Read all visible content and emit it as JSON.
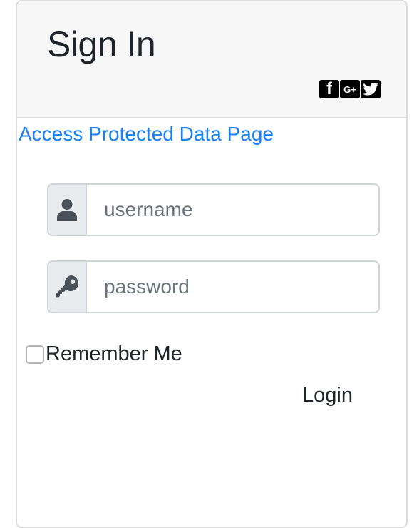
{
  "header": {
    "title": "Sign In",
    "social": [
      {
        "name": "facebook",
        "glyph": "f"
      },
      {
        "name": "google-plus",
        "glyph": "G+"
      },
      {
        "name": "twitter",
        "glyph": "twitter-bird"
      }
    ]
  },
  "links": {
    "protected": "Access Protected Data Page"
  },
  "form": {
    "username_placeholder": "username",
    "password_placeholder": "password",
    "remember_label": "Remember Me",
    "remember_checked": false,
    "login_label": "Login"
  },
  "colors": {
    "link": "#1a7ff0",
    "header_bg": "#f7f7f7",
    "addon_bg": "#e9ecef",
    "icon": "#495057",
    "text": "#212529"
  }
}
